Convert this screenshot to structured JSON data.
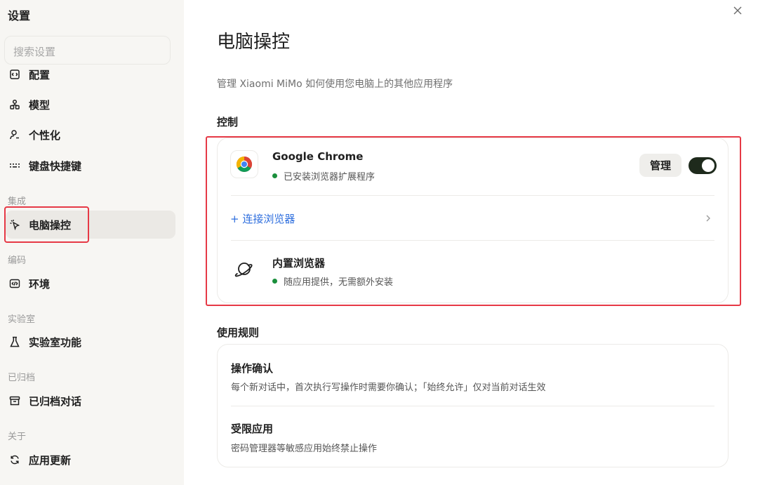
{
  "sidebar": {
    "title": "设置",
    "search_placeholder": "搜索设置",
    "items": [
      {
        "label": "配置",
        "icon": "config-icon"
      },
      {
        "label": "模型",
        "icon": "model-icon"
      },
      {
        "label": "个性化",
        "icon": "person-icon"
      },
      {
        "label": "键盘快捷键",
        "icon": "keyboard-icon"
      },
      {
        "label": "电脑操控",
        "icon": "cursor-icon",
        "active": true
      },
      {
        "label": "环境",
        "icon": "code-icon"
      },
      {
        "label": "实验室功能",
        "icon": "flask-icon"
      },
      {
        "label": "已归档对话",
        "icon": "archive-icon"
      },
      {
        "label": "应用更新",
        "icon": "refresh-icon"
      }
    ],
    "groups": {
      "integration": "集成",
      "coding": "编码",
      "labs": "实验室",
      "archived": "已归档",
      "about": "关于"
    }
  },
  "main": {
    "title": "电脑操控",
    "description": "管理 Xiaomi MiMo 如何使用您电脑上的其他应用程序",
    "control": {
      "section_label": "控制",
      "chrome": {
        "name": "Google Chrome",
        "status": "已安装浏览器扩展程序",
        "manage_label": "管理",
        "enabled": true
      },
      "connect_label": "+ 连接浏览器",
      "builtin": {
        "name": "内置浏览器",
        "status": "随应用提供，无需额外安装"
      }
    },
    "rules": {
      "section_label": "使用规则",
      "items": [
        {
          "title": "操作确认",
          "description": "每个新对话中，首次执行写操作时需要你确认；「始终允许」仅对当前对话生效"
        },
        {
          "title": "受限应用",
          "description": "密码管理器等敏感应用始终禁止操作"
        }
      ]
    }
  },
  "colors": {
    "accent_link": "#2f6fde",
    "status_green": "#1a8f3c",
    "highlight_red": "#e63946",
    "toggle_on": "#1e2a1c"
  }
}
